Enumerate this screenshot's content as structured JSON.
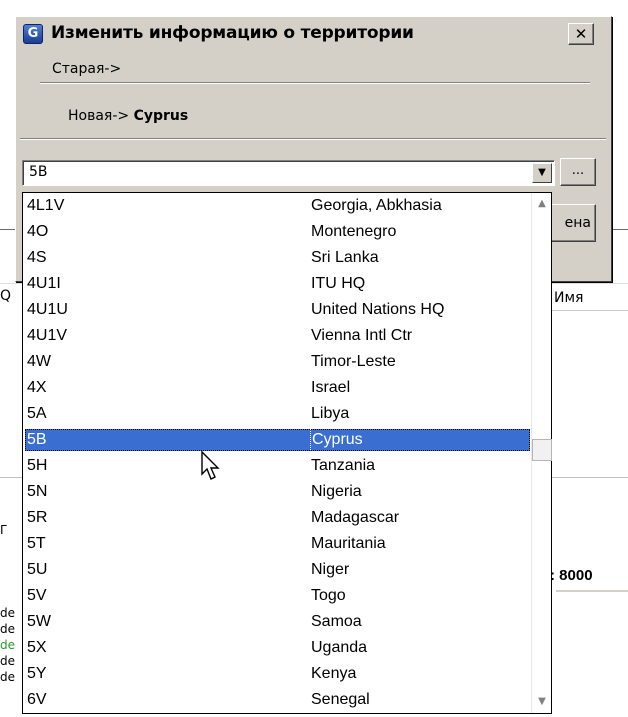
{
  "background": {
    "left_letters": [
      "Q",
      "Γ",
      "de",
      "de",
      "de",
      "de",
      "de"
    ],
    "name_header": "Имя",
    "frequency_fragment": ": 8000"
  },
  "dialog": {
    "title": "Изменить информацию о территории",
    "close_glyph": "✕",
    "old_label": "Старая->",
    "new_label": "Новая->",
    "new_value": "Cyprus",
    "ellipsis_label": "...",
    "cancel_label": "ена"
  },
  "combo": {
    "selected_value": "5B"
  },
  "list": {
    "items": [
      {
        "code": "4L1V",
        "name": "Georgia, Abkhasia"
      },
      {
        "code": "4O",
        "name": "Montenegro"
      },
      {
        "code": "4S",
        "name": "Sri Lanka"
      },
      {
        "code": "4U1I",
        "name": "ITU HQ"
      },
      {
        "code": "4U1U",
        "name": "United Nations HQ"
      },
      {
        "code": "4U1V",
        "name": "Vienna Intl Ctr"
      },
      {
        "code": "4W",
        "name": "Timor-Leste"
      },
      {
        "code": "4X",
        "name": "Israel"
      },
      {
        "code": "5A",
        "name": "Libya"
      },
      {
        "code": "5B",
        "name": "Cyprus",
        "selected": true
      },
      {
        "code": "5H",
        "name": "Tanzania"
      },
      {
        "code": "5N",
        "name": "Nigeria"
      },
      {
        "code": "5R",
        "name": "Madagascar"
      },
      {
        "code": "5T",
        "name": "Mauritania"
      },
      {
        "code": "5U",
        "name": "Niger"
      },
      {
        "code": "5V",
        "name": "Togo"
      },
      {
        "code": "5W",
        "name": "Samoa"
      },
      {
        "code": "5X",
        "name": "Uganda"
      },
      {
        "code": "5Y",
        "name": "Kenya"
      },
      {
        "code": "6V",
        "name": "Senegal"
      }
    ]
  },
  "colors": {
    "dialog_face": "#d4d0c8",
    "selection": "#3a6fd1"
  }
}
